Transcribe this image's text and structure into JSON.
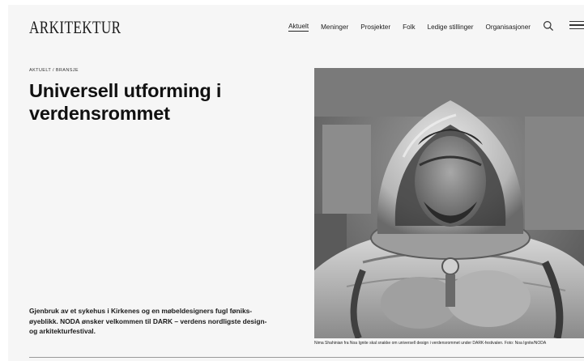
{
  "header": {
    "logo": "ARKITEKTUR",
    "nav": [
      {
        "label": "Aktuelt",
        "active": true
      },
      {
        "label": "Meninger",
        "active": false
      },
      {
        "label": "Prosjekter",
        "active": false
      },
      {
        "label": "Folk",
        "active": false
      },
      {
        "label": "Ledige stillinger",
        "active": false
      },
      {
        "label": "Organisasjoner",
        "active": false
      }
    ],
    "icons": [
      "search-icon",
      "hamburger-menu-icon"
    ]
  },
  "article": {
    "kicker": "Aktuelt / Bransje",
    "headline": "Universell utforming i verdensrommet",
    "lead": "Gjenbruk av et sykehus i Kirkenes og en møbeldesigners fugl føniks-øyeblikk. NODA ønsker velkommen til DARK – verdens nordligste design- og arkitekturfestival.",
    "image": {
      "caption": "Nima Shahinian fra Noa Ignite skal snakke om universell design i verdensrommet under DARK-festivalen.  Foto: Noa Ignite/NODA"
    }
  },
  "colors": {
    "background": "#f6f6f6",
    "text": "#111111"
  }
}
